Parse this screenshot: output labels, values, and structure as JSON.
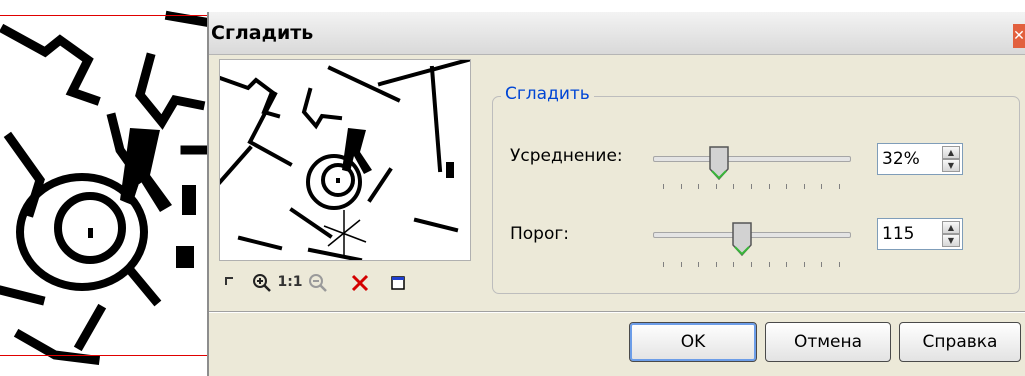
{
  "dialog": {
    "title": "Сгладить",
    "close_icon": "close-icon"
  },
  "preview": {
    "toolbar": {
      "zoom_in_icon": "zoom-in-icon",
      "actual_size_label": "1:1",
      "zoom_out_icon": "zoom-out-icon",
      "delete_icon": "delete-x-icon",
      "frame_icon": "frame-icon"
    }
  },
  "group": {
    "legend": "Сгладить",
    "averaging": {
      "label": "Усреднение:",
      "value": "32%",
      "level": 32
    },
    "threshold": {
      "label": "Порог:",
      "value": "115",
      "level": 115
    }
  },
  "buttons": {
    "ok": "OK",
    "cancel": "Отмена",
    "help": "Справка"
  },
  "colors": {
    "dialog_bg": "#ece9d8",
    "legend_text": "#0046d5",
    "guide_line": "#e00000",
    "close_button": "#e2603e"
  }
}
